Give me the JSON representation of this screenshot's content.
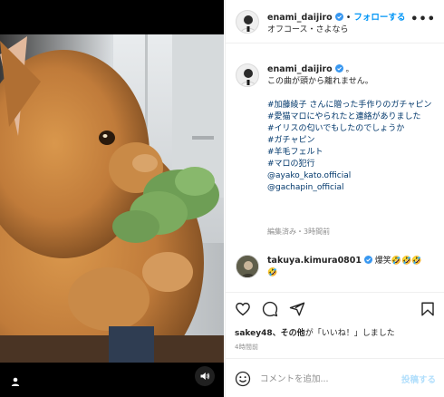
{
  "header": {
    "username": "enami_daijiro",
    "follow_label": "フォローする",
    "separator": "•",
    "subtitle": "オフコース・さよなら",
    "more_icon": "more-horizontal-icon"
  },
  "caption": {
    "username": "enami_daijiro",
    "punct": "。",
    "lines": [
      "この曲が頭から離れません。"
    ],
    "hashtag_lines": [
      "#加藤綾子 さんに贈った手作りのガチャピン",
      "#愛猫マロにやられたと連絡がありました",
      "#イリスの匂いでもしたのでしょうか",
      "#ガチャピン",
      "#羊毛フェルト",
      "#マロの犯行",
      "@ayako_kato.official",
      "@gachapin_official"
    ],
    "meta": "編集済み・3時間前"
  },
  "comment": {
    "username": "takuya.kimura0801",
    "text": "爆笑🤣🤣🤣",
    "text_cont": "🤣"
  },
  "actions": {
    "like_icon": "heart-icon",
    "comment_icon": "comment-icon",
    "share_icon": "paper-plane-icon",
    "save_icon": "bookmark-icon"
  },
  "likes": {
    "user": "sakey48",
    "others": "、その他",
    "suffix": "が「いいね！」しました"
  },
  "time": "4時間前",
  "comment_box": {
    "emoji_icon": "smile-icon",
    "placeholder": "コメントを追加...",
    "post_label": "投稿する"
  },
  "colors": {
    "accent": "#0095f6",
    "tag": "#00376b",
    "muted": "#8e8e8e",
    "post_disabled": "#b2dffc"
  }
}
